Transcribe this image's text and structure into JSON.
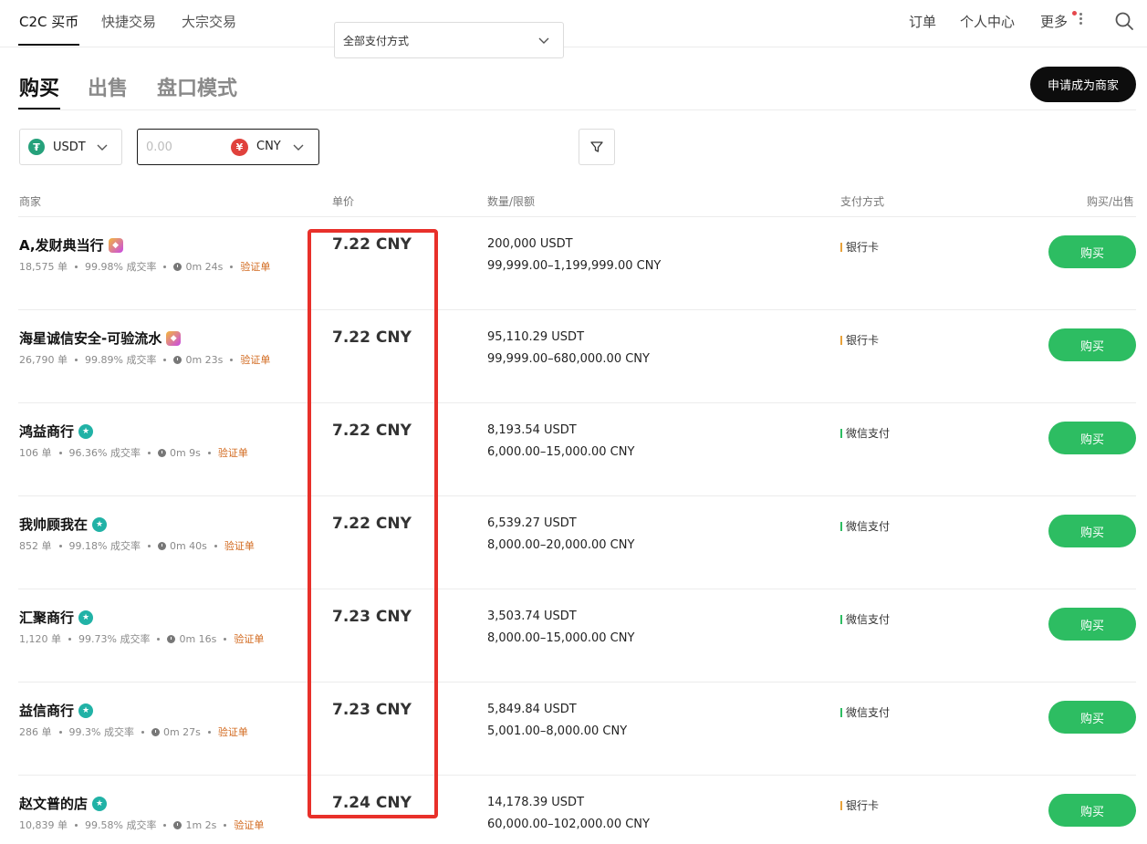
{
  "topnav": {
    "tabs": [
      "C2C 买币",
      "快捷交易",
      "大宗交易"
    ],
    "links": [
      "订单",
      "个人中心",
      "更多"
    ]
  },
  "subtabs": [
    "购买",
    "出售",
    "盘口模式"
  ],
  "merchant_button": "申请成为商家",
  "filters": {
    "coin": "USDT",
    "amount_placeholder": "0.00",
    "currency": "CNY",
    "currency_symbol": "¥",
    "coin_symbol": "₮",
    "payment": "全部支付方式"
  },
  "table": {
    "headers": [
      "商家",
      "单价",
      "数量/限额",
      "支付方式",
      "购买/出售"
    ],
    "rows": [
      {
        "name": "A,发财典当行",
        "badge": "diamond",
        "orders": "18,575 单",
        "rate": "99.98% 成交率",
        "time": "0m 24s",
        "verify": "验证单",
        "price": "7.22 CNY",
        "qty": "200,000 USDT",
        "limit": "99,999.00–1,199,999.00 CNY",
        "pay": "银行卡",
        "pay_color": "#e8a23a",
        "action": "购买"
      },
      {
        "name": "海星诚信安全-可验流水",
        "badge": "diamond",
        "orders": "26,790 单",
        "rate": "99.89% 成交率",
        "time": "0m 23s",
        "verify": "验证单",
        "price": "7.22 CNY",
        "qty": "95,110.29 USDT",
        "limit": "99,999.00–680,000.00 CNY",
        "pay": "银行卡",
        "pay_color": "#e8a23a",
        "action": "购买"
      },
      {
        "name": "鸿益商行",
        "badge": "star",
        "orders": "106 单",
        "rate": "96.36% 成交率",
        "time": "0m 9s",
        "verify": "验证单",
        "price": "7.22 CNY",
        "qty": "8,193.54 USDT",
        "limit": "6,000.00–15,000.00 CNY",
        "pay": "微信支付",
        "pay_color": "#2dbd62",
        "action": "购买"
      },
      {
        "name": "我帅顾我在",
        "badge": "star",
        "orders": "852 单",
        "rate": "99.18% 成交率",
        "time": "0m 40s",
        "verify": "验证单",
        "price": "7.22 CNY",
        "qty": "6,539.27 USDT",
        "limit": "8,000.00–20,000.00 CNY",
        "pay": "微信支付",
        "pay_color": "#2dbd62",
        "action": "购买"
      },
      {
        "name": "汇聚商行",
        "badge": "star",
        "orders": "1,120 单",
        "rate": "99.73% 成交率",
        "time": "0m 16s",
        "verify": "验证单",
        "price": "7.23 CNY",
        "qty": "3,503.74 USDT",
        "limit": "8,000.00–15,000.00 CNY",
        "pay": "微信支付",
        "pay_color": "#2dbd62",
        "action": "购买"
      },
      {
        "name": "益信商行",
        "badge": "star",
        "orders": "286 单",
        "rate": "99.3% 成交率",
        "time": "0m 27s",
        "verify": "验证单",
        "price": "7.23 CNY",
        "qty": "5,849.84 USDT",
        "limit": "5,001.00–8,000.00 CNY",
        "pay": "微信支付",
        "pay_color": "#2dbd62",
        "action": "购买"
      },
      {
        "name": "赵文普的店",
        "badge": "star",
        "orders": "10,839 单",
        "rate": "99.58% 成交率",
        "time": "1m 2s",
        "verify": "验证单",
        "price": "7.24 CNY",
        "qty": "14,178.39 USDT",
        "limit": "60,000.00–102,000.00 CNY",
        "pay": "银行卡",
        "pay_color": "#e8a23a",
        "action": "购买"
      }
    ]
  },
  "colors": {
    "buy_green": "#2dbd62",
    "highlight_red": "#e8302a",
    "verify_orange": "#d2691e"
  }
}
